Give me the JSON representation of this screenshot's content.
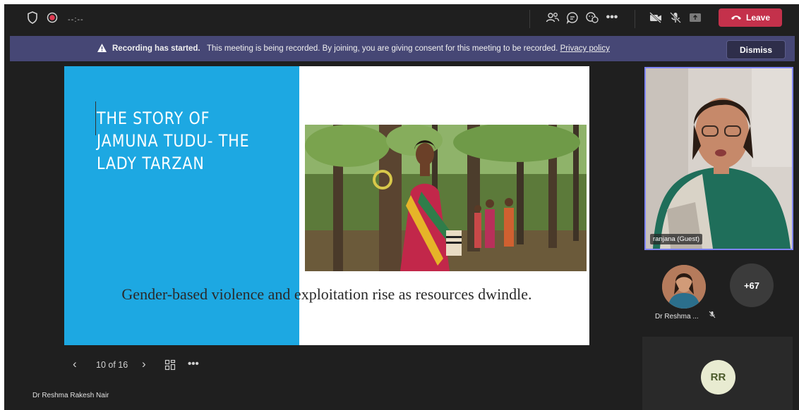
{
  "topbar": {
    "timer": "--:--",
    "leave_label": "Leave",
    "icons": [
      "shield-icon",
      "record-icon",
      "people-icon",
      "chat-icon",
      "reactions-icon",
      "more-icon",
      "camera-off-icon",
      "mic-off-icon",
      "share-icon",
      "phone-icon"
    ]
  },
  "banner": {
    "title": "Recording has started.",
    "message": "This meeting is being recorded. By joining, you are giving consent for this meeting to be recorded.",
    "link": "Privacy policy",
    "dismiss_label": "Dismiss"
  },
  "slide": {
    "title_line1": "THE STORY OF",
    "title_line2": "JAMUNA TUDU- THE",
    "title_line3": "LADY TARZAN",
    "caption": "Gender-based violence and exploitation rise as resources dwindle.",
    "accent_color": "#1da8e2"
  },
  "slide_controls": {
    "page_indicator": "10 of 16"
  },
  "presenter": {
    "name": "Dr Reshma Rakesh Nair"
  },
  "participants": {
    "video_name": "ranjana (Guest)",
    "avatar_name": "Dr Reshma ...",
    "more_count": "+67",
    "initials": "RR"
  },
  "colors": {
    "leave": "#c4314b",
    "banner": "#464775",
    "active_border": "#7f85f5"
  }
}
